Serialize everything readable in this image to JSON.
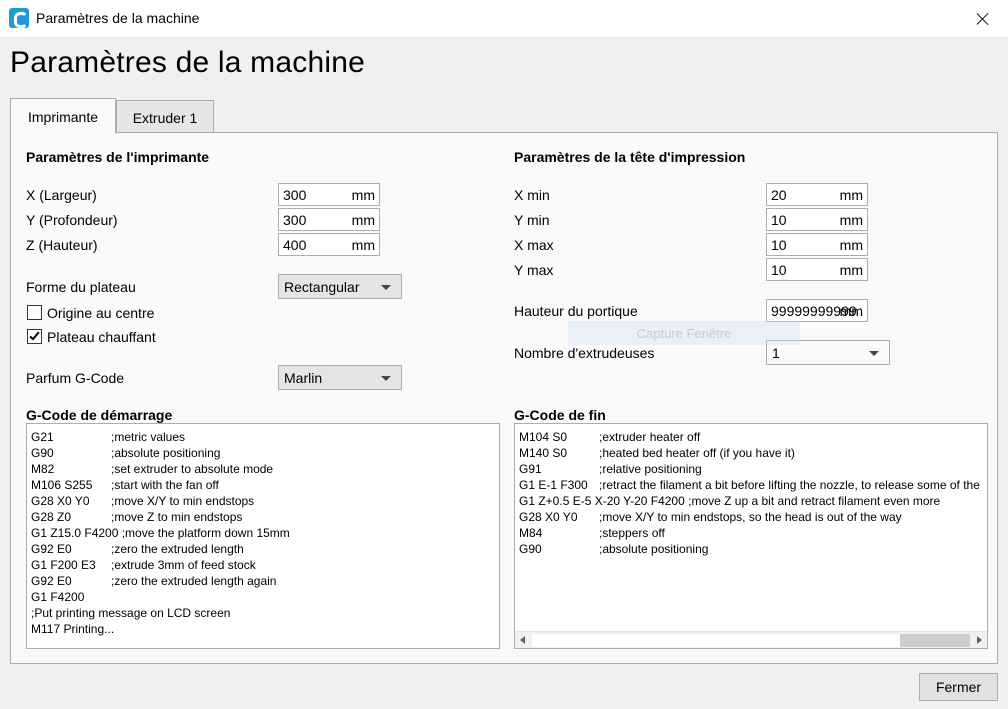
{
  "window": {
    "title": "Paramètres de la machine",
    "close_icon": "close-icon"
  },
  "page_title": "Paramètres de la machine",
  "tabs": [
    {
      "label": "Imprimante",
      "active": true
    },
    {
      "label": "Extruder 1",
      "active": false
    }
  ],
  "printer": {
    "section_title": "Paramètres de l'imprimante",
    "x_label": "X (Largeur)",
    "x_value": "300",
    "x_unit": "mm",
    "y_label": "Y (Profondeur)",
    "y_value": "300",
    "y_unit": "mm",
    "z_label": "Z (Hauteur)",
    "z_value": "400",
    "z_unit": "mm",
    "bed_shape_label": "Forme du plateau",
    "bed_shape_value": "Rectangular",
    "origin_center_label": "Origine au centre",
    "origin_center_checked": false,
    "heated_bed_label": "Plateau chauffant",
    "heated_bed_checked": true,
    "gcode_flavor_label": "Parfum G-Code",
    "gcode_flavor_value": "Marlin"
  },
  "printhead": {
    "section_title": "Paramètres de la tête d'impression",
    "xmin_label": "X min",
    "xmin_value": "20",
    "xmin_unit": "mm",
    "ymin_label": "Y min",
    "ymin_value": "10",
    "ymin_unit": "mm",
    "xmax_label": "X max",
    "xmax_value": "10",
    "xmax_unit": "mm",
    "ymax_label": "Y max",
    "ymax_value": "10",
    "ymax_unit": "mm",
    "gantry_label": "Hauteur du portique",
    "gantry_value": "99999999999",
    "gantry_unit": "mm",
    "extruders_label": "Nombre d'extrudeuses",
    "extruders_value": "1"
  },
  "overlay_text": "Capture Fenêtre",
  "start_gcode": {
    "title": "G-Code de démarrage",
    "lines": [
      [
        "G21",
        ";metric values"
      ],
      [
        "G90",
        ";absolute positioning"
      ],
      [
        "M82",
        ";set extruder to absolute mode"
      ],
      [
        "M106 S255",
        ";start with the fan off"
      ],
      [
        "G28 X0 Y0",
        ";move X/Y to min endstops"
      ],
      [
        "G28 Z0",
        ";move Z to min endstops"
      ],
      [
        "G1 Z15.0 F4200 ;move the platform down 15mm",
        ""
      ],
      [
        "G92 E0",
        ";zero the extruded length"
      ],
      [
        "G1 F200 E3",
        ";extrude 3mm of feed stock"
      ],
      [
        "G92 E0",
        ";zero the extruded length again"
      ],
      [
        "G1 F4200",
        ""
      ],
      [
        ";Put printing message on LCD screen",
        ""
      ],
      [
        "M117 Printing...",
        ""
      ]
    ]
  },
  "end_gcode": {
    "title": "G-Code de fin",
    "lines": [
      [
        "M104 S0",
        ";extruder heater off"
      ],
      [
        "M140 S0",
        ";heated bed heater off (if you have it)"
      ],
      [
        "G91",
        ";relative positioning"
      ],
      [
        "G1 E-1 F300",
        ";retract the filament a bit before lifting the nozzle, to release some of the pressure"
      ],
      [
        "G1 Z+0.5 E-5 X-20 Y-20 F4200 ;move Z up a bit and retract filament even more",
        ""
      ],
      [
        "G28 X0 Y0",
        ";move X/Y to min endstops, so the head is out of the way"
      ],
      [
        "M84",
        ";steppers off"
      ],
      [
        "G90",
        ";absolute positioning"
      ]
    ]
  },
  "footer": {
    "close_label": "Fermer"
  }
}
